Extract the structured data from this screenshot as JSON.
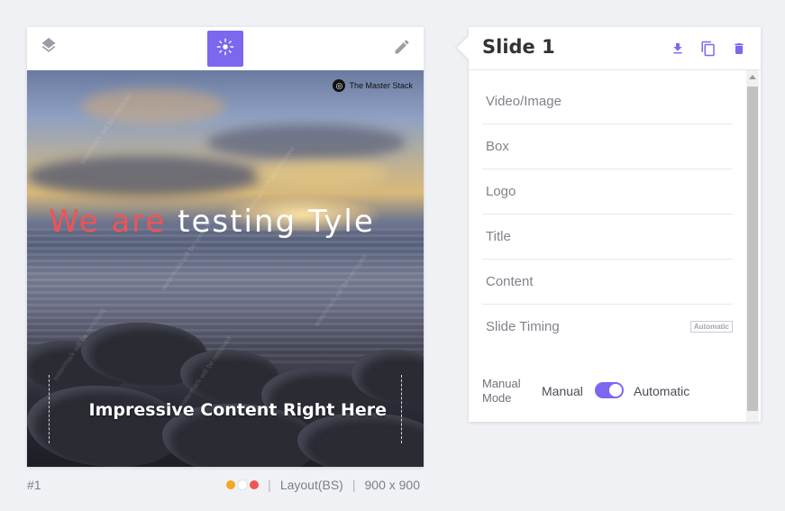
{
  "toolbar": {
    "layers_icon": "layers-icon",
    "center_icon": "crosshair-icon",
    "edit_icon": "pencil-icon",
    "accent": "#7b68ee"
  },
  "canvas": {
    "brand": "The Master Stack",
    "headline_red": "We are",
    "headline_white": "testing Tyle",
    "content": "Impressive Content Right Here"
  },
  "footer": {
    "number": "#1",
    "colors": [
      "#f5a623",
      "#ffffff",
      "#f05454"
    ],
    "layout": "Layout(BS)",
    "size": "900 x 900"
  },
  "panel": {
    "title": "Slide 1",
    "items": [
      {
        "label": "Video/Image"
      },
      {
        "label": "Box"
      },
      {
        "label": "Logo"
      },
      {
        "label": "Title"
      },
      {
        "label": "Content"
      },
      {
        "label": "Slide Timing",
        "badge": "Automatic"
      }
    ],
    "manual_mode_label": "Manual Mode",
    "option_manual": "Manual",
    "option_automatic": "Automatic",
    "toggle_state": "Automatic"
  }
}
